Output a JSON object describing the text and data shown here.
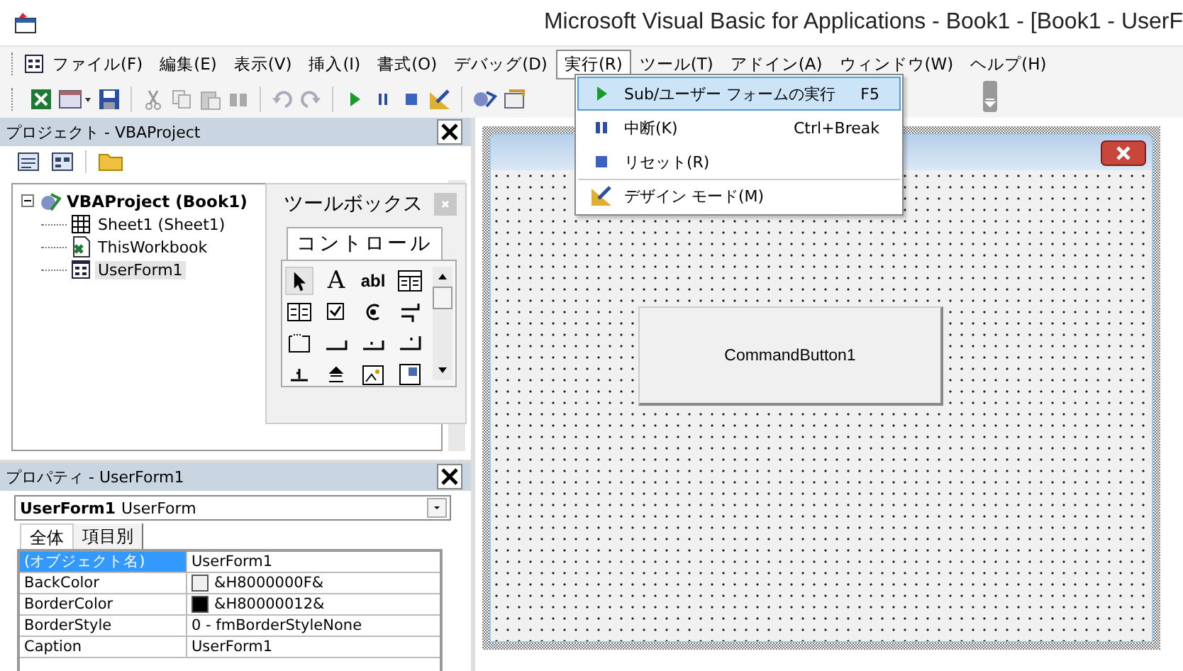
{
  "window": {
    "title": "Microsoft Visual Basic for Applications - Book1 - [Book1 - UserF"
  },
  "menu": [
    {
      "label": "ファイル(F)",
      "selected": false
    },
    {
      "label": "編集(E)",
      "selected": false
    },
    {
      "label": "表示(V)",
      "selected": false
    },
    {
      "label": "挿入(I)",
      "selected": false
    },
    {
      "label": "書式(O)",
      "selected": false
    },
    {
      "label": "デバッグ(D)",
      "selected": false
    },
    {
      "label": "実行(R)",
      "selected": true
    },
    {
      "label": "ツール(T)",
      "selected": false
    },
    {
      "label": "アドイン(A)",
      "selected": false
    },
    {
      "label": "ウィンドウ(W)",
      "selected": false
    },
    {
      "label": "ヘルプ(H)",
      "selected": false
    }
  ],
  "run_menu": [
    {
      "kind": "run",
      "label": "Sub/ユーザー フォームの実行",
      "shortcut": "F5",
      "selected": true
    },
    {
      "kind": "pause",
      "label": "中断(K)",
      "shortcut": "Ctrl+Break",
      "selected": false
    },
    {
      "kind": "stop",
      "label": "リセット(R)",
      "selected": false
    },
    {
      "kind": "design",
      "label": "デザイン モード(M)",
      "selected": false
    }
  ],
  "project": {
    "title": "プロジェクト - VBAProject",
    "tree": [
      {
        "label": "VBAProject (Book1)",
        "expanded": true,
        "selected": false,
        "children": [
          {
            "kind": "sheet",
            "label": "Sheet1 (Sheet1)",
            "selected": false
          },
          {
            "kind": "workbook",
            "label": "ThisWorkbook",
            "selected": false
          },
          {
            "kind": "form",
            "label": "UserForm1",
            "selected": true
          }
        ]
      }
    ]
  },
  "toolbox": {
    "title": "ツールボックス",
    "tab": "コントロール",
    "glyphs": [
      "A",
      "abl"
    ]
  },
  "properties": {
    "title": "プロパティ - UserForm1",
    "object": {
      "name": "UserForm1",
      "type": "UserForm"
    },
    "tabs": [
      {
        "label": "全体",
        "selected": true
      },
      {
        "label": "項目別",
        "selected": false
      }
    ],
    "rows": [
      {
        "name": "(オブジェクト名)",
        "value": "UserForm1",
        "selected": true
      },
      {
        "name": "BackColor",
        "value": "&H8000000F&",
        "color": "#f0f0f0",
        "selected": false
      },
      {
        "name": "BorderColor",
        "value": "&H80000012&",
        "color": "#000000",
        "selected": false
      },
      {
        "name": "BorderStyle",
        "value": "0 - fmBorderStyleNone",
        "selected": false
      },
      {
        "name": "Caption",
        "value": "UserForm1",
        "selected": false
      }
    ]
  },
  "form": {
    "button": "CommandButton1"
  }
}
